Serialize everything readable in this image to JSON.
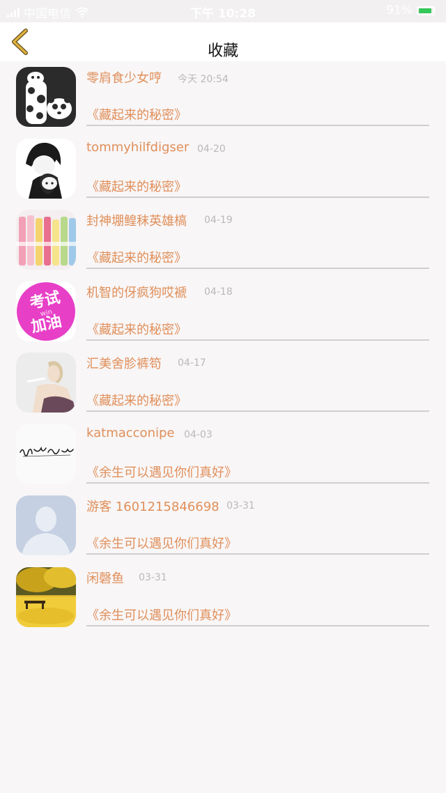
{
  "status_bar": {
    "carrier": "中国电信",
    "time": "下午 10:28",
    "battery_percent_text": "91%",
    "battery_level": 0.91,
    "wifi_icon": "wifi-icon"
  },
  "nav": {
    "title": "收藏",
    "back_icon": "chevron-left-icon",
    "back_color": "#e0b040"
  },
  "colors": {
    "accent_text": "#e08f5a",
    "date_text": "#b9b9b9",
    "divider": "#cfcfcf",
    "background": "#f8f6f7"
  },
  "items": [
    {
      "user": "零肩食少女哼",
      "date": "今天 20:54",
      "book": "《藏起来的秘密》",
      "avatar": "giraffe-cartoon-avatar"
    },
    {
      "user": "tommyhilfdigser",
      "date": "04-20",
      "book": "《藏起来的秘密》",
      "avatar": "anime-couple-avatar"
    },
    {
      "user": "封神堋鳇秣英雄槁",
      "date": "04-19",
      "book": "《藏起来的秘密》",
      "avatar": "color-pens-avatar"
    },
    {
      "user": "机智的伢疯狗哎褫",
      "date": "04-18",
      "book": "《藏起来的秘密》",
      "avatar": "exam-cheer-avatar",
      "avatar_text": [
        "考试",
        "win",
        "加油"
      ]
    },
    {
      "user": "汇美舍胗裤笱",
      "date": "04-17",
      "book": "《藏起来的秘密》",
      "avatar": "woman-photo-avatar"
    },
    {
      "user": "katmacconipe",
      "date": "04-03",
      "book": "《余生可以遇见你们真好》",
      "avatar": "handwriting-avatar"
    },
    {
      "user": "游客 1601215846698",
      "date": "03-31",
      "book": "《余生可以遇见你们真好》",
      "avatar": "default-user-avatar"
    },
    {
      "user": "闲磬鱼",
      "date": "03-31",
      "book": "《余生可以遇见你们真好》",
      "avatar": "autumn-bench-avatar"
    }
  ]
}
